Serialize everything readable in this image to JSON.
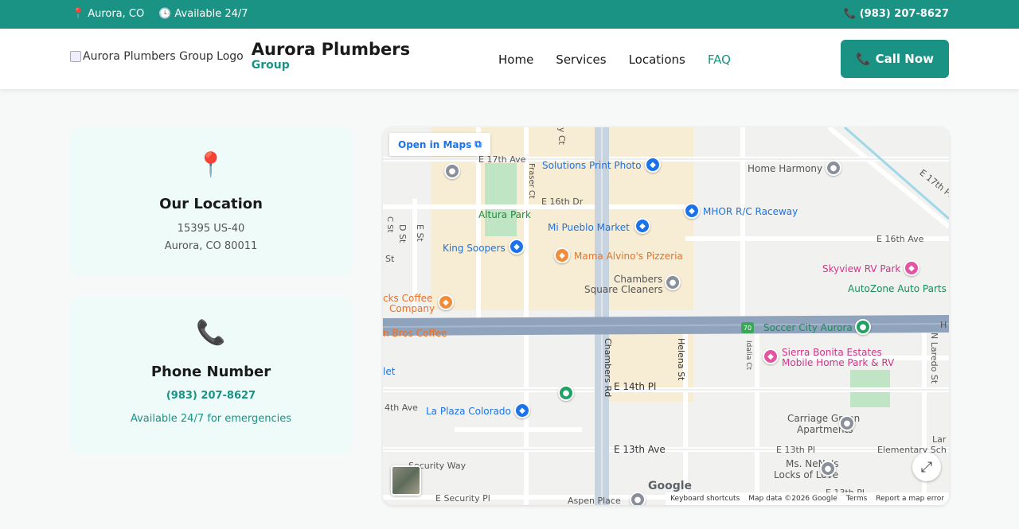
{
  "topbar": {
    "location_icon": "map-pin-icon",
    "location": "Aurora, CO",
    "clock_icon": "clock-icon",
    "availability": "Available 24/7",
    "phone_icon": "phone-icon",
    "phone": "(983) 207-8627"
  },
  "header": {
    "logo_alt": "Aurora Plumbers Group Logo",
    "brand_title": "Aurora Plumbers",
    "brand_subtitle": "Group",
    "nav": [
      {
        "label": "Home",
        "active": false
      },
      {
        "label": "Services",
        "active": false
      },
      {
        "label": "Locations",
        "active": false
      },
      {
        "label": "FAQ",
        "active": true
      }
    ],
    "call_button": "Call Now"
  },
  "location_card": {
    "icon": "map-pin-icon",
    "title": "Our Location",
    "address_line1": "15395 US-40",
    "address_line2": "Aurora, CO 80011"
  },
  "phone_card": {
    "icon": "phone-icon",
    "title": "Phone Number",
    "phone": "(983) 207-8627",
    "note": "Available 24/7 for emergencies"
  },
  "map": {
    "open_in_maps": "Open in Maps",
    "google": "Google",
    "attribution": {
      "shortcuts": "Keyboard shortcuts",
      "data": "Map data ©2026 Google",
      "terms": "Terms",
      "report": "Report a map error"
    },
    "streets": {
      "e17": "E 17th Ave",
      "e16dr": "E 16th Dr",
      "e16": "E 16th Ave",
      "e17pl": "E 17th Pl",
      "e14pl": "E 14th Pl",
      "e14ave": "4th Ave",
      "e13ave": "E 13th Ave",
      "e13pl": "E 13th Pl",
      "e13pl2": "E 13th Pl",
      "security_way": "Security Way",
      "security_pl": "E Security Pl",
      "aspen": "Aspen Place",
      "chambers": "Chambers Rd",
      "helena": "Helena St",
      "idalia": "Idalia Ct",
      "laredo": "N Laredo St",
      "fraser": "Fraser Ct",
      "dst": "D St",
      "est": "E St",
      "cst": "C St",
      "st": "St",
      "yct": "y Ct",
      "elem": "Elementary Sch",
      "lar": "Lar",
      "h": "H"
    },
    "pois": {
      "solutions": "Solutions Print Photo",
      "home_harmony": "Home Harmony",
      "altura": "Altura Park",
      "mhor": "MHOR R/C Raceway",
      "mi_pueblo": "Mi Pueblo Market",
      "king_soopers": "King Soopers",
      "mama_alvino": "Mama Alvino's Pizzeria",
      "skyview": "Skyview RV Park",
      "chambers_cleaners1": "Chambers",
      "chambers_cleaners2": "Square Cleaners",
      "autozone": "AutoZone Auto Parts",
      "coffee1": "cks Coffee",
      "coffee2": "Company",
      "soccer": "Soccer City Aurora",
      "bros": "n Bros Coffee",
      "sierra1": "Sierra Bonita Estates",
      "sierra2": "Mobile Home Park & RV",
      "let": "let",
      "la_plaza": "La Plaza Colorado",
      "carriage1": "Carriage Green",
      "carriage2": "Apartments",
      "nene1": "Ms. NeNe's",
      "nene2": "Locks of Love",
      "route": "70"
    }
  }
}
